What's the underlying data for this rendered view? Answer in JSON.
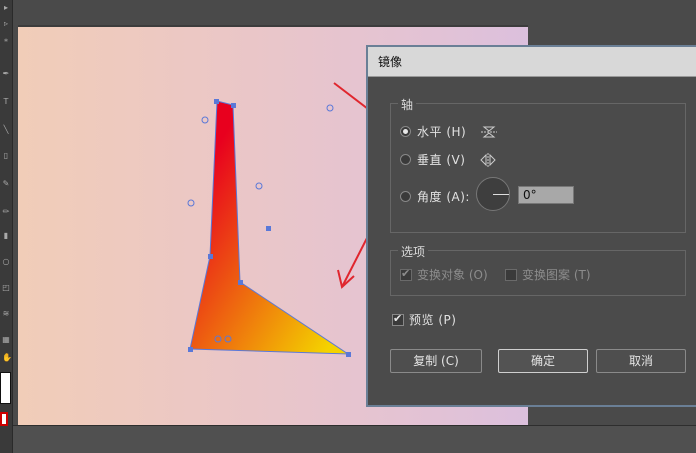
{
  "dialog": {
    "title": "镜像",
    "axis_group_label": "轴",
    "horizontal_label": "水平 (H)",
    "vertical_label": "垂直 (V)",
    "angle_label": "角度 (A):",
    "angle_value": "0°",
    "selected_axis": "horizontal",
    "options_group_label": "选项",
    "transform_objects_label": "变换对象 (O)",
    "transform_patterns_label": "变换图案 (T)",
    "transform_objects_checked": true,
    "transform_patterns_checked": false,
    "preview_label": "预览 (P)",
    "preview_checked": true,
    "copy_button": "复制 (C)",
    "ok_button": "确定",
    "cancel_button": "取消"
  },
  "artwork": {
    "gradient_colors": [
      "#e8001e",
      "#f4d200"
    ],
    "annotation_color": "#e0262e"
  }
}
